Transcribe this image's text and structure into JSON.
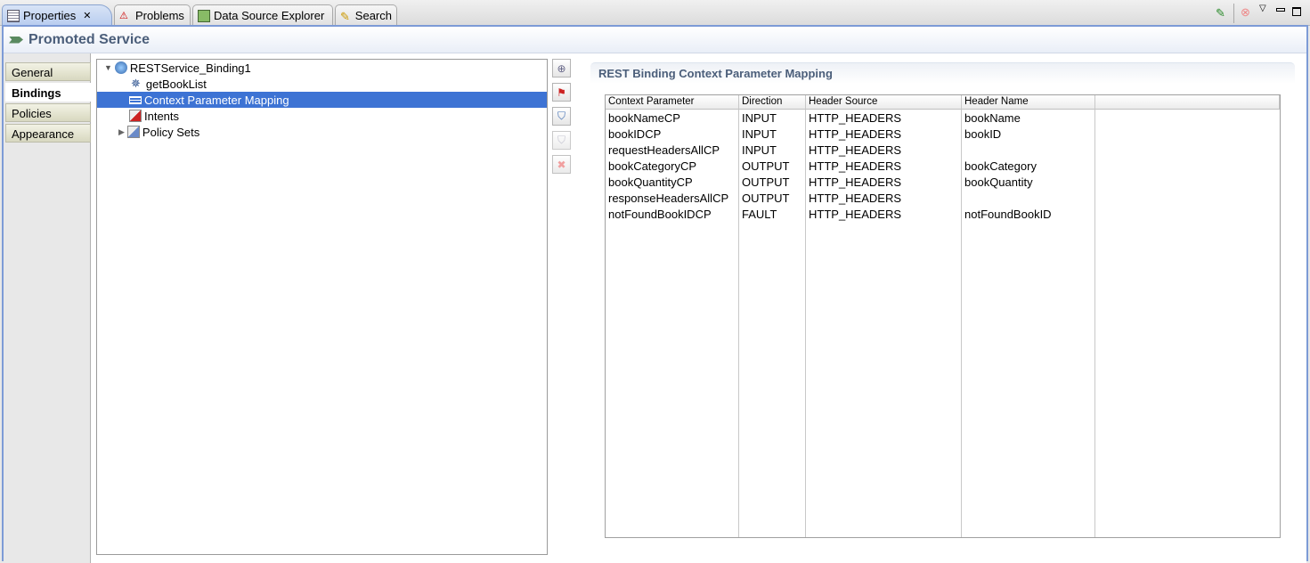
{
  "tabs": [
    {
      "label": "Properties",
      "icon": "properties-icon"
    },
    {
      "label": "Problems",
      "icon": "problems-icon"
    },
    {
      "label": "Data Source Explorer",
      "icon": "data-source-icon"
    },
    {
      "label": "Search",
      "icon": "search-icon"
    }
  ],
  "title": "Promoted Service",
  "left_tabs": [
    "General",
    "Bindings",
    "Policies",
    "Appearance"
  ],
  "selected_left_tab": "Bindings",
  "tree": [
    {
      "label": "RESTService_Binding1",
      "icon": "rest-binding-icon",
      "expanded": true
    },
    {
      "label": "getBookList",
      "icon": "operation-gear-icon"
    },
    {
      "label": "Context Parameter Mapping",
      "icon": "mapping-icon",
      "selected": true
    },
    {
      "label": "Intents",
      "icon": "intents-folder-icon"
    },
    {
      "label": "Policy Sets",
      "icon": "policy-sets-folder-icon",
      "expanded": false
    }
  ],
  "section_title": "REST Binding Context Parameter Mapping",
  "table": {
    "headers": [
      "Context Parameter",
      "Direction",
      "Header Source",
      "Header Name",
      ""
    ],
    "rows": [
      [
        "bookNameCP",
        "INPUT",
        "HTTP_HEADERS",
        "bookName"
      ],
      [
        "bookIDCP",
        "INPUT",
        "HTTP_HEADERS",
        "bookID"
      ],
      [
        "requestHeadersAllCP",
        "INPUT",
        "HTTP_HEADERS",
        ""
      ],
      [
        "bookCategoryCP",
        "OUTPUT",
        "HTTP_HEADERS",
        "bookCategory"
      ],
      [
        "bookQuantityCP",
        "OUTPUT",
        "HTTP_HEADERS",
        "bookQuantity"
      ],
      [
        "responseHeadersAllCP",
        "OUTPUT",
        "HTTP_HEADERS",
        ""
      ],
      [
        "notFoundBookIDCP",
        "FAULT",
        "HTTP_HEADERS",
        "notFoundBookID"
      ]
    ]
  },
  "colors": {
    "accent": "#3d73d4",
    "frame": "#7d9bd6",
    "title": "#4b5e7a"
  }
}
